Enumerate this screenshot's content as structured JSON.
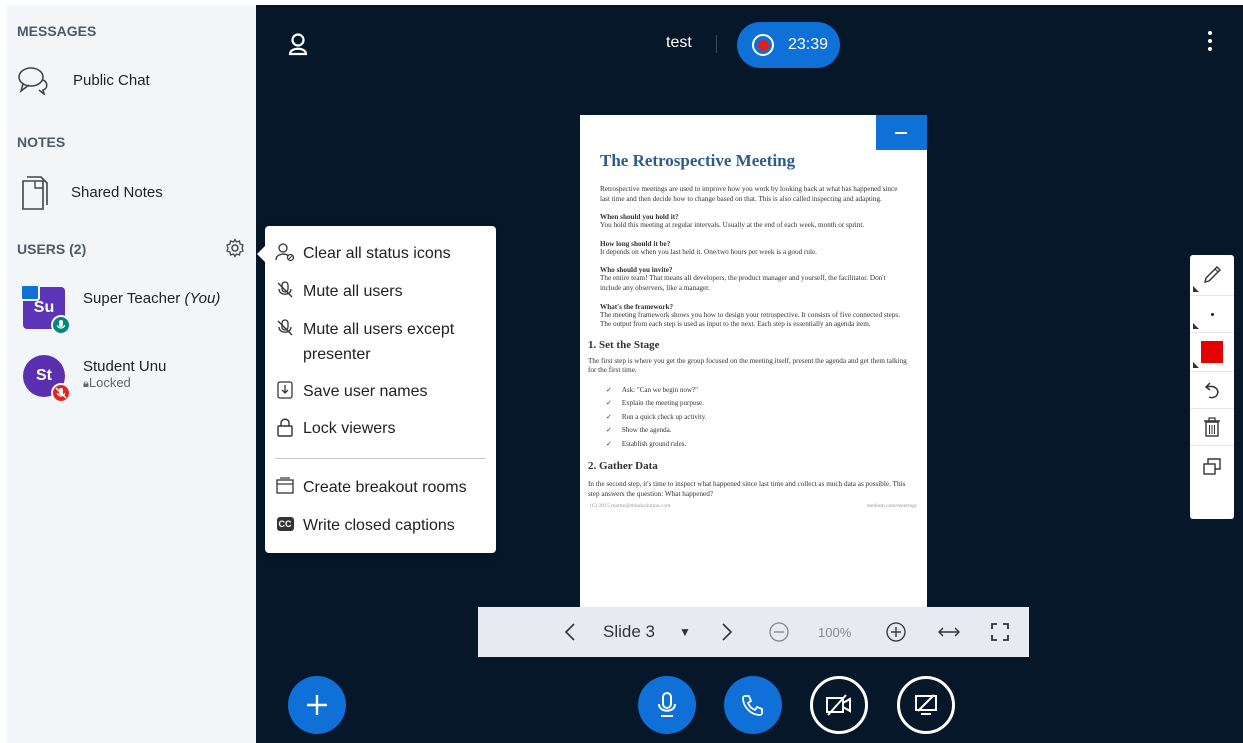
{
  "sidebar": {
    "messages_title": "MESSAGES",
    "public_chat": "Public Chat",
    "notes_title": "NOTES",
    "shared_notes": "Shared Notes",
    "users_title": "USERS (2)",
    "users": [
      {
        "initials": "Su",
        "name": "Super Teacher",
        "you": "(You)",
        "status": ""
      },
      {
        "initials": "St",
        "name": "Student Unu",
        "status": "Locked"
      }
    ]
  },
  "topbar": {
    "title": "test",
    "timer": "23:39"
  },
  "slide_doc": {
    "title": "The Retrospective Meeting",
    "intro": "Retrospective meetings are used to improve how you work by looking back at what has happened since last time and then decide how to change based on that. This is also called inspecting and adapting.",
    "q1": "When should you hold it?",
    "a1": "You hold this meeting at regular intervals. Usually at the end of each week, month or sprint.",
    "q2": "How long should it be?",
    "a2": "It depends on when you last held it. One/two hours per week is a good rule.",
    "q3": "Who should you invite?",
    "a3": "The entire team! That means all developers, the product manager and yourself, the facilitator. Don't include any observers, like a manager.",
    "q4": "What's the framework?",
    "a4": "The meeting framework shows you how to design your retrospective. It consists of five connected steps. The output from each step is used as input to the next. Each step is essentially an agenda item.",
    "h_stage": "1. Set the Stage",
    "stage_text": "The first step is where you get the group focused on the meeting itself, present the agenda and get them talking for the first time.",
    "checklist": [
      "Ask: \"Can we begin now?\"",
      "Explain the meeting purpose.",
      "Run a quick check up activity.",
      "Show the agenda.",
      "Establish ground rules."
    ],
    "h_data": "2. Gather Data",
    "data_text": "In the second step, it's time to inspect what happened since last time and collect as much data as possible. This step answers the question: What happened?",
    "footer_left": "(C) 2015 martin@mindsolution.com",
    "footer_right": "medium.com/meetings"
  },
  "slide_nav": {
    "label": "Slide 3",
    "zoom": "100%"
  },
  "whiteboard": {
    "pen_color": "#e60000"
  },
  "settings_menu": {
    "items": [
      "Clear all status icons",
      "Mute all users",
      "Mute all users except presenter",
      "Save user names",
      "Lock viewers",
      "Create breakout rooms",
      "Write closed captions"
    ]
  },
  "colors": {
    "accent": "#0f70d7",
    "main_bg": "#06172a",
    "sidebar_bg": "#f3f6f9"
  }
}
